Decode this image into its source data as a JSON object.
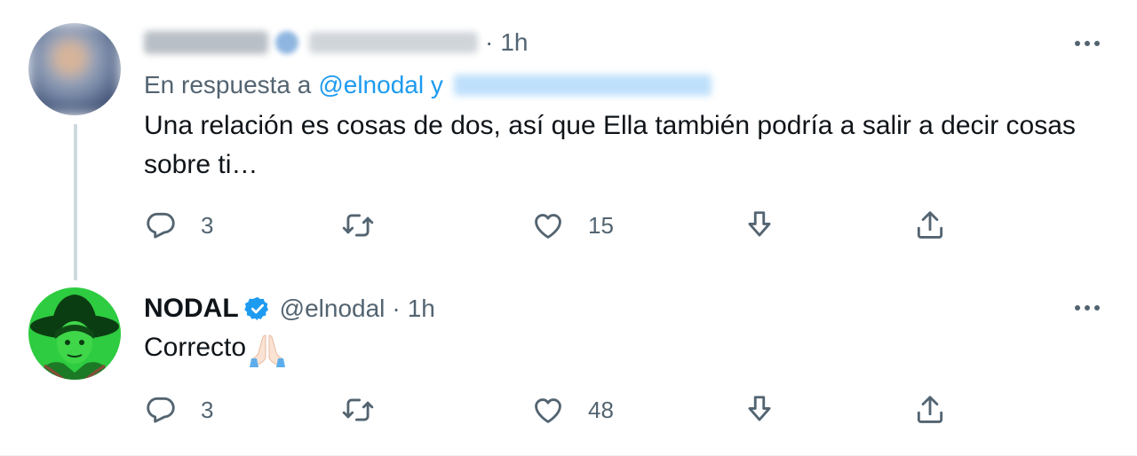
{
  "tweets": [
    {
      "time": "1h",
      "reply_prefix": "En respuesta a",
      "reply_handle": "@elnodal y",
      "text": "Una relación es cosas de dos, así que Ella también podría a salir a decir cosas sobre ti…",
      "replies": "3",
      "likes": "15"
    },
    {
      "name": "NODAL",
      "handle": "@elnodal",
      "time": "1h",
      "text": "Correcto",
      "replies": "3",
      "likes": "48"
    }
  ],
  "colors": {
    "accent": "#1d9bf0",
    "muted": "#536471",
    "avatar_green": "#2ecc40"
  },
  "icons": [
    "reply-icon",
    "retweet-icon",
    "like-icon",
    "download-icon",
    "share-icon",
    "more-icon",
    "verified-badge-icon",
    "praying-hands-emoji"
  ]
}
